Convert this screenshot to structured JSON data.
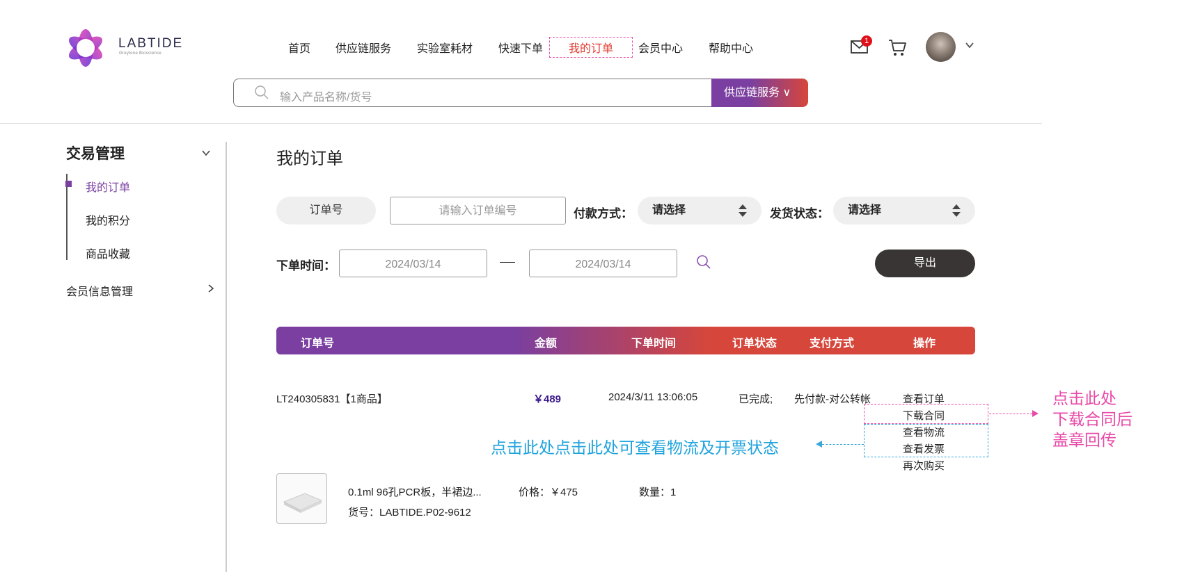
{
  "brand": {
    "name": "LABTIDE",
    "tagline": "Greytone Bioscience"
  },
  "nav": [
    "首页",
    "供应链服务",
    "实验室耗材",
    "快速下单",
    "我的订单",
    "会员中心",
    "帮助中心"
  ],
  "header": {
    "mail_badge": "1"
  },
  "search": {
    "placeholder": "输入产品名称/货号",
    "button_label": "供应链服务 ∨"
  },
  "sidebar": {
    "title": "交易管理",
    "items": [
      "我的订单",
      "我的积分",
      "商品收藏"
    ],
    "member": "会员信息管理"
  },
  "main": {
    "title": "我的订单",
    "filters": {
      "order_no_label": "订单号",
      "order_no_placeholder": "请输入订单编号",
      "pay_label": "付款方式：",
      "pay_value": "请选择",
      "ship_label": "发货状态：",
      "ship_value": "请选择",
      "time_label": "下单时间：",
      "date_from": "2024/03/14",
      "date_to": "2024/03/14",
      "export_label": "导出"
    },
    "table_headers": [
      "订单号",
      "金额",
      "下单时间",
      "订单状态",
      "支付方式",
      "操作"
    ],
    "order": {
      "id": "LT240305831【1商品】",
      "amount": "￥489",
      "time": "2024/3/11 13:06:05",
      "status": "已完成;",
      "payment": "先付款-对公转帐",
      "actions": [
        "查看订单",
        "下载合同",
        "查看物流",
        "查看发票",
        "再次购买"
      ]
    },
    "product": {
      "name": "0.1ml 96孔PCR板，半裙边...",
      "sku": "货号：LABTIDE.P02-9612",
      "price": "价格：￥475",
      "qty": "数量：1"
    }
  },
  "annotations": {
    "blue": "点击此处点击此处可查看物流及开票状态",
    "pink": [
      "点击此处",
      "下载合同后",
      "盖章回传"
    ]
  },
  "colors": {
    "purple": "#7a3fa0",
    "red": "#d6463b",
    "pink": "#e84aa8",
    "blue": "#1fa3dd"
  }
}
